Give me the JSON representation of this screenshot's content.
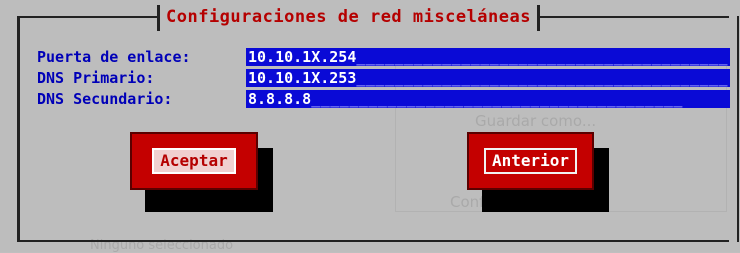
{
  "dialog": {
    "title": "Configuraciones de red misceláneas"
  },
  "fields": [
    {
      "label": "Puerta de enlace:",
      "value": "10.10.1X.254",
      "fill": "_______________________________________"
    },
    {
      "label": "DNS Primario:",
      "value": "10.10.1X.253",
      "fill": "_______________________________________"
    },
    {
      "label": "DNS Secundario:",
      "value": "8.8.8.8",
      "fill": "_______________________________________"
    }
  ],
  "buttons": {
    "accept": "Aceptar",
    "back": "Anterior"
  },
  "background_ghost": {
    "save_as": "Guardar como...",
    "bottom_text": "Configurar por copia",
    "status_left": "Ninguno seleccionado"
  },
  "colors": {
    "background": "#bdbdbd",
    "title": "#b50000",
    "label": "#0000b8",
    "field": "#0a0ad6",
    "button": "#c40000"
  }
}
